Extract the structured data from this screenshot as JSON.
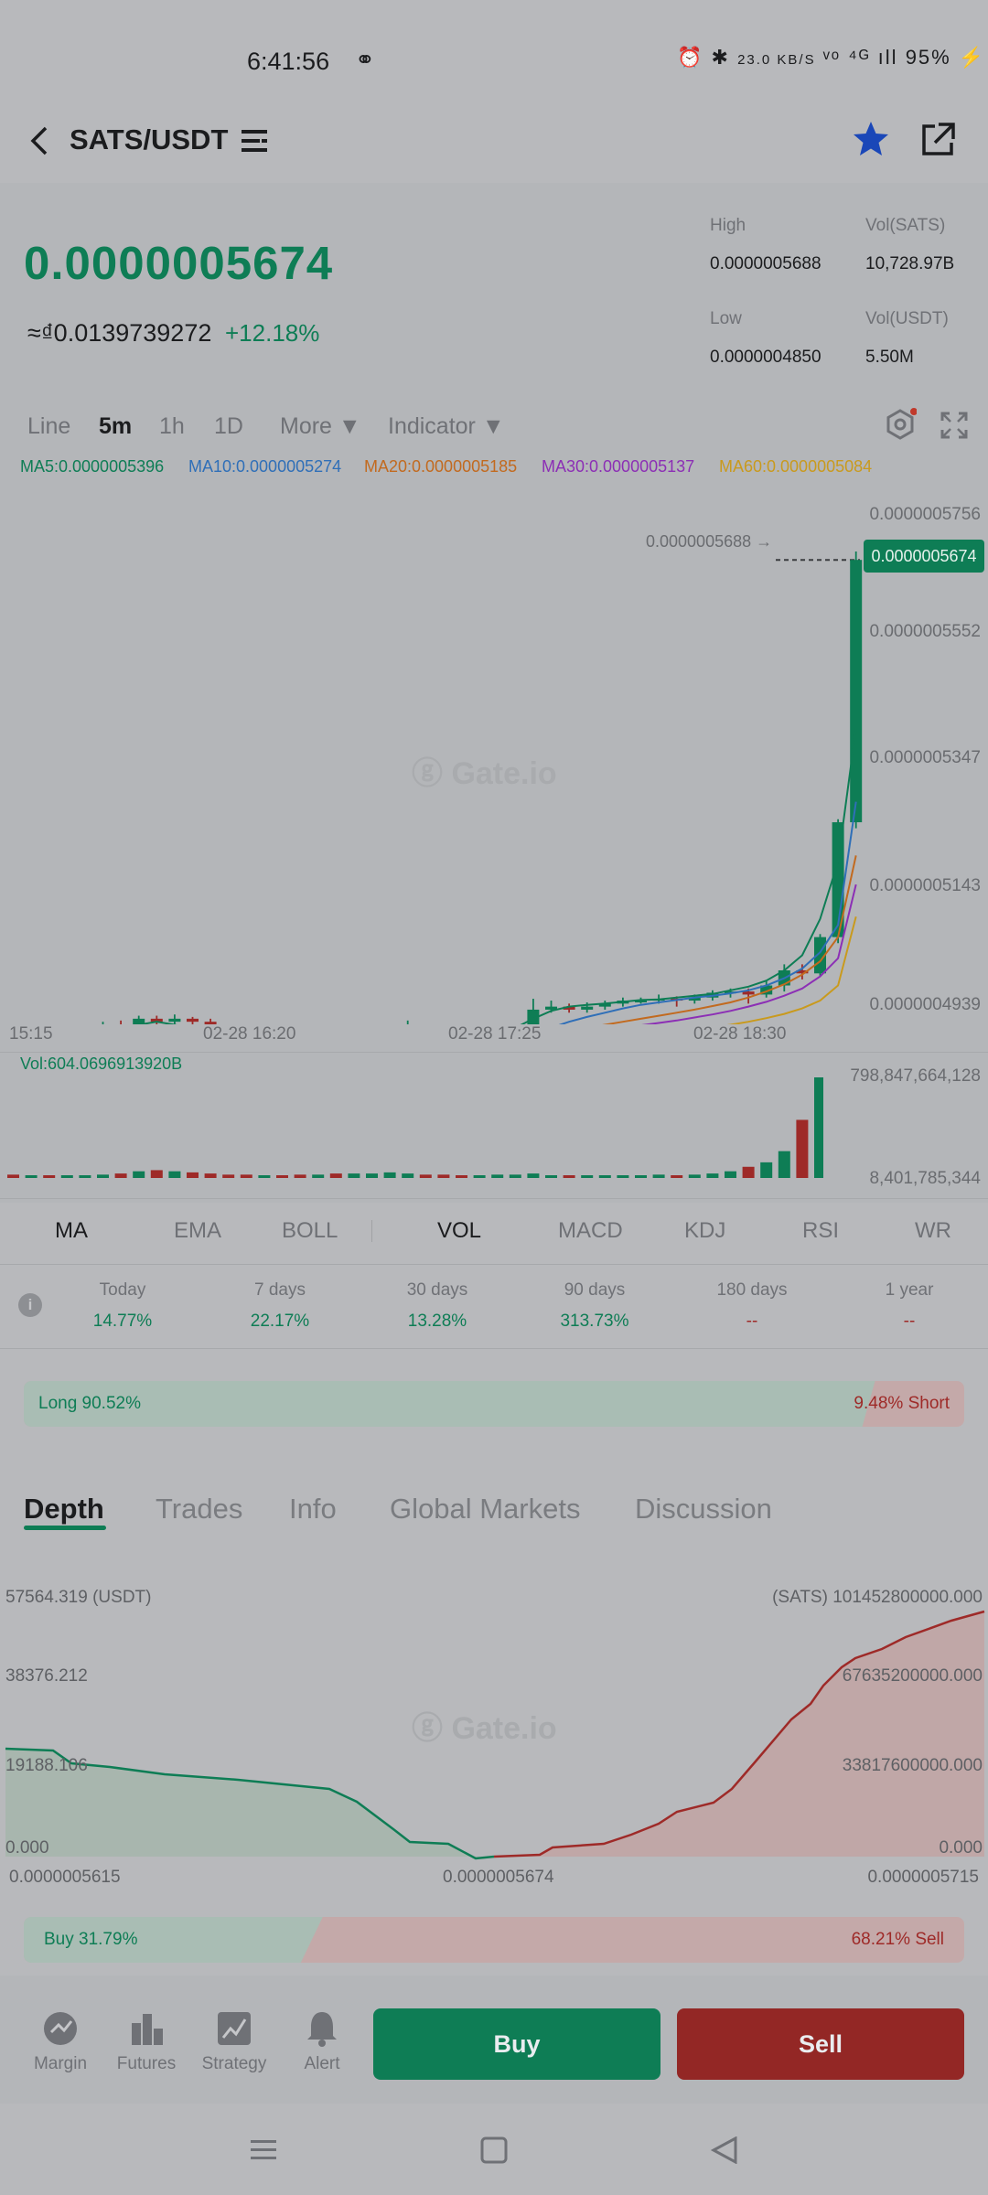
{
  "status": {
    "time": "6:41:56",
    "icons_text": "⏰ ✱ 23.0 KB/S Vo LTE ⁴⁴ᴳ .ıll 95%",
    "battery": "95%",
    "net_speed": "23.0 KB/S"
  },
  "header": {
    "pair": "SATS/USDT",
    "back_icon": "chevron-left-icon",
    "menu_icon": "list-icon",
    "favorite_icon": "star-icon",
    "share_icon": "share-icon"
  },
  "ticker": {
    "price": "0.0000005674",
    "approx": "≈₫0.0139739272",
    "change": "+12.18%",
    "high_label": "High",
    "high": "0.0000005688",
    "low_label": "Low",
    "low": "0.0000004850",
    "vol_sats_label": "Vol(SATS)",
    "vol_sats": "10,728.97B",
    "vol_usdt_label": "Vol(USDT)",
    "vol_usdt": "5.50M"
  },
  "timeframes": {
    "line": "Line",
    "m5": "5m",
    "h1": "1h",
    "d1": "1D",
    "more": "More ▼",
    "indicator": "Indicator ▼"
  },
  "ma_legend": {
    "ma5": "MA5:0.0000005396",
    "ma10": "MA10:0.0000005274",
    "ma20": "MA20:0.0000005185",
    "ma30": "MA30:0.0000005137",
    "ma60": "MA60:0.0000005084"
  },
  "colors": {
    "up": "#0e7d55",
    "down": "#9e2a28",
    "ma5": "#0e7d55",
    "ma10": "#2f6fb8",
    "ma20": "#c26a1f",
    "ma30": "#8c2fb5",
    "ma60": "#c99a1d"
  },
  "chart": {
    "y_ticks": [
      "0.0000005756",
      "0.0000005552",
      "0.0000005347",
      "0.0000005143",
      "0.0000004939"
    ],
    "x_ticks": [
      "15:15",
      "02-28 16:20",
      "02-28 17:25",
      "02-28 18:30"
    ],
    "high_marker": "0.0000005688 →",
    "last_price_tag": "0.0000005674",
    "watermark": "Gate.io",
    "vol_label": "Vol:604.0696913920B",
    "vol_max": "798,847,664,128",
    "vol_min": "8,401,785,344"
  },
  "chart_data": {
    "type": "candlestick",
    "ylim": [
      4.939e-07,
      5.756e-07
    ],
    "x_ticks": [
      "15:15",
      "02-28 16:20",
      "02-28 17:25",
      "02-28 18:30"
    ],
    "candles": [
      {
        "o": 4878,
        "c": 4868,
        "h": 4885,
        "l": 4858
      },
      {
        "o": 4868,
        "c": 4872,
        "h": 4880,
        "l": 4860
      },
      {
        "o": 4872,
        "c": 4865,
        "h": 4878,
        "l": 4858
      },
      {
        "o": 4865,
        "c": 4870,
        "h": 4875,
        "l": 4860
      },
      {
        "o": 4870,
        "c": 4885,
        "h": 4890,
        "l": 4865
      },
      {
        "o": 4885,
        "c": 4905,
        "h": 4910,
        "l": 4880
      },
      {
        "o": 4905,
        "c": 4895,
        "h": 4912,
        "l": 4888
      },
      {
        "o": 4895,
        "c": 4915,
        "h": 4920,
        "l": 4890
      },
      {
        "o": 4915,
        "c": 4910,
        "h": 4920,
        "l": 4905
      },
      {
        "o": 4910,
        "c": 4915,
        "h": 4922,
        "l": 4905
      },
      {
        "o": 4915,
        "c": 4910,
        "h": 4918,
        "l": 4905
      },
      {
        "o": 4910,
        "c": 4895,
        "h": 4915,
        "l": 4880
      },
      {
        "o": 4895,
        "c": 4880,
        "h": 4900,
        "l": 4855
      },
      {
        "o": 4880,
        "c": 4870,
        "h": 4885,
        "l": 4865
      },
      {
        "o": 4870,
        "c": 4872,
        "h": 4878,
        "l": 4862
      },
      {
        "o": 4872,
        "c": 4868,
        "h": 4878,
        "l": 4862
      },
      {
        "o": 4868,
        "c": 4862,
        "h": 4872,
        "l": 4852
      },
      {
        "o": 4862,
        "c": 4870,
        "h": 4876,
        "l": 4855
      },
      {
        "o": 4870,
        "c": 4868,
        "h": 4875,
        "l": 4862
      },
      {
        "o": 4868,
        "c": 4872,
        "h": 4878,
        "l": 4862
      },
      {
        "o": 4872,
        "c": 4878,
        "h": 4885,
        "l": 4866
      },
      {
        "o": 4878,
        "c": 4895,
        "h": 4900,
        "l": 4875
      },
      {
        "o": 4895,
        "c": 4898,
        "h": 4912,
        "l": 4890
      },
      {
        "o": 4898,
        "c": 4872,
        "h": 4902,
        "l": 4860
      },
      {
        "o": 4872,
        "c": 4865,
        "h": 4878,
        "l": 4855
      },
      {
        "o": 4865,
        "c": 4862,
        "h": 4870,
        "l": 4850
      },
      {
        "o": 4862,
        "c": 4872,
        "h": 4878,
        "l": 4855
      },
      {
        "o": 4872,
        "c": 4878,
        "h": 4882,
        "l": 4868
      },
      {
        "o": 4878,
        "c": 4898,
        "h": 4905,
        "l": 4872
      },
      {
        "o": 4898,
        "c": 4930,
        "h": 4948,
        "l": 4895
      },
      {
        "o": 4930,
        "c": 4935,
        "h": 4945,
        "l": 4925
      },
      {
        "o": 4935,
        "c": 4930,
        "h": 4940,
        "l": 4925
      },
      {
        "o": 4930,
        "c": 4935,
        "h": 4942,
        "l": 4925
      },
      {
        "o": 4935,
        "c": 4940,
        "h": 4945,
        "l": 4930
      },
      {
        "o": 4940,
        "c": 4945,
        "h": 4950,
        "l": 4935
      },
      {
        "o": 4945,
        "c": 4945,
        "h": 4950,
        "l": 4940
      },
      {
        "o": 4945,
        "c": 4948,
        "h": 4955,
        "l": 4940
      },
      {
        "o": 4948,
        "c": 4945,
        "h": 4952,
        "l": 4935
      },
      {
        "o": 4945,
        "c": 4950,
        "h": 4955,
        "l": 4940
      },
      {
        "o": 4950,
        "c": 4958,
        "h": 4962,
        "l": 4945
      },
      {
        "o": 4958,
        "c": 4960,
        "h": 4965,
        "l": 4950
      },
      {
        "o": 4960,
        "c": 4955,
        "h": 4965,
        "l": 4940
      },
      {
        "o": 4955,
        "c": 4970,
        "h": 4978,
        "l": 4950
      },
      {
        "o": 4970,
        "c": 4995,
        "h": 5005,
        "l": 4960
      },
      {
        "o": 4995,
        "c": 4990,
        "h": 5005,
        "l": 4980
      },
      {
        "o": 4990,
        "c": 5050,
        "h": 5055,
        "l": 4985
      },
      {
        "o": 5050,
        "c": 5240,
        "h": 5245,
        "l": 5040
      },
      {
        "o": 5240,
        "c": 5674,
        "h": 5688,
        "l": 5230
      }
    ],
    "ma5": [
      4875,
      4874,
      4872,
      4873,
      4880,
      4895,
      4900,
      4905,
      4910,
      4905,
      4900,
      4895,
      4885,
      4878,
      4872,
      4868,
      4868,
      4870,
      4871,
      4873,
      4880,
      4888,
      4885,
      4880,
      4870,
      4868,
      4872,
      4885,
      4900,
      4915,
      4928,
      4935,
      4938,
      4940,
      4943,
      4946,
      4947,
      4950,
      4953,
      4956,
      4962,
      4968,
      4978,
      4995,
      5020,
      5080,
      5175,
      5396
    ],
    "ma10": [
      4875,
      4875,
      4874,
      4873,
      4875,
      4880,
      4885,
      4890,
      4895,
      4898,
      4900,
      4900,
      4898,
      4894,
      4888,
      4882,
      4877,
      4874,
      4872,
      4871,
      4872,
      4876,
      4878,
      4878,
      4876,
      4874,
      4874,
      4877,
      4883,
      4891,
      4900,
      4910,
      4918,
      4925,
      4932,
      4938,
      4942,
      4946,
      4950,
      4953,
      4957,
      4962,
      4970,
      4982,
      4998,
      5025,
      5070,
      5274
    ],
    "ma20": [
      4876,
      4876,
      4876,
      4876,
      4876,
      4877,
      4878,
      4880,
      4882,
      4884,
      4886,
      4888,
      4889,
      4889,
      4889,
      4888,
      4887,
      4886,
      4885,
      4884,
      4883,
      4882,
      4881,
      4880,
      4879,
      4879,
      4880,
      4882,
      4884,
      4887,
      4890,
      4895,
      4900,
      4905,
      4910,
      4915,
      4920,
      4925,
      4930,
      4936,
      4942,
      4950,
      4960,
      4972,
      4988,
      5010,
      5050,
      5185
    ],
    "ma30": [
      4877,
      4877,
      4877,
      4877,
      4877,
      4878,
      4878,
      4879,
      4880,
      4881,
      4882,
      4883,
      4884,
      4884,
      4884,
      4884,
      4884,
      4884,
      4883,
      4883,
      4883,
      4883,
      4883,
      4882,
      4882,
      4882,
      4882,
      4883,
      4884,
      4886,
      4888,
      4890,
      4893,
      4896,
      4900,
      4904,
      4908,
      4912,
      4917,
      4922,
      4928,
      4935,
      4943,
      4953,
      4965,
      4985,
      5015,
      5137
    ],
    "ma60": [
      4872,
      4872,
      4872,
      4873,
      4873,
      4873,
      4874,
      4874,
      4875,
      4875,
      4876,
      4876,
      4877,
      4877,
      4877,
      4877,
      4877,
      4877,
      4877,
      4877,
      4877,
      4877,
      4877,
      4877,
      4877,
      4877,
      4878,
      4878,
      4879,
      4880,
      4881,
      4882,
      4884,
      4886,
      4888,
      4890,
      4892,
      4895,
      4898,
      4901,
      4905,
      4910,
      4916,
      4923,
      4932,
      4945,
      4970,
      5084
    ],
    "volume": [
      3,
      2,
      1,
      1,
      2,
      3,
      4,
      6,
      7,
      6,
      5,
      4,
      3,
      3,
      2,
      2,
      3,
      3,
      4,
      4,
      4,
      5,
      4,
      3,
      3,
      2,
      2,
      3,
      3,
      4,
      2,
      1,
      1,
      2,
      2,
      2,
      3,
      2,
      3,
      4,
      6,
      10,
      14,
      24,
      52,
      90,
      64
    ]
  },
  "indicators": {
    "ma": "MA",
    "ema": "EMA",
    "boll": "BOLL",
    "vol": "VOL",
    "macd": "MACD",
    "kdj": "KDJ",
    "rsi": "RSI",
    "wr": "WR"
  },
  "performance": [
    {
      "label": "Today",
      "value": "14.77%"
    },
    {
      "label": "7 days",
      "value": "22.17%"
    },
    {
      "label": "30 days",
      "value": "13.28%"
    },
    {
      "label": "90 days",
      "value": "313.73%"
    },
    {
      "label": "180 days",
      "value": "--"
    },
    {
      "label": "1 year",
      "value": "--"
    }
  ],
  "long_short": {
    "long": "Long 90.52%",
    "short": "9.48% Short",
    "long_ratio": 0.9052
  },
  "detail_tabs": {
    "depth": "Depth",
    "trades": "Trades",
    "info": "Info",
    "global": "Global Markets",
    "discussion": "Discussion"
  },
  "depth": {
    "left_top": "57564.319 (USDT)",
    "left_mid": "38376.212",
    "left_low": "19188.106",
    "left_zero": "0.000",
    "right_top": "(SATS) 101452800000.000",
    "right_mid": "67635200000.000",
    "right_low": "33817600000.000",
    "right_zero": "0.000",
    "x_left": "0.0000005615",
    "x_mid": "0.0000005674",
    "x_right": "0.0000005715",
    "watermark": "Gate.io"
  },
  "buy_sell_ratio": {
    "buy": "Buy 31.79%",
    "sell": "68.21% Sell",
    "buy_ratio": 0.3179
  },
  "bottom_bar": {
    "margin": "Margin",
    "futures": "Futures",
    "strategy": "Strategy",
    "alert": "Alert",
    "buy": "Buy",
    "sell": "Sell"
  }
}
